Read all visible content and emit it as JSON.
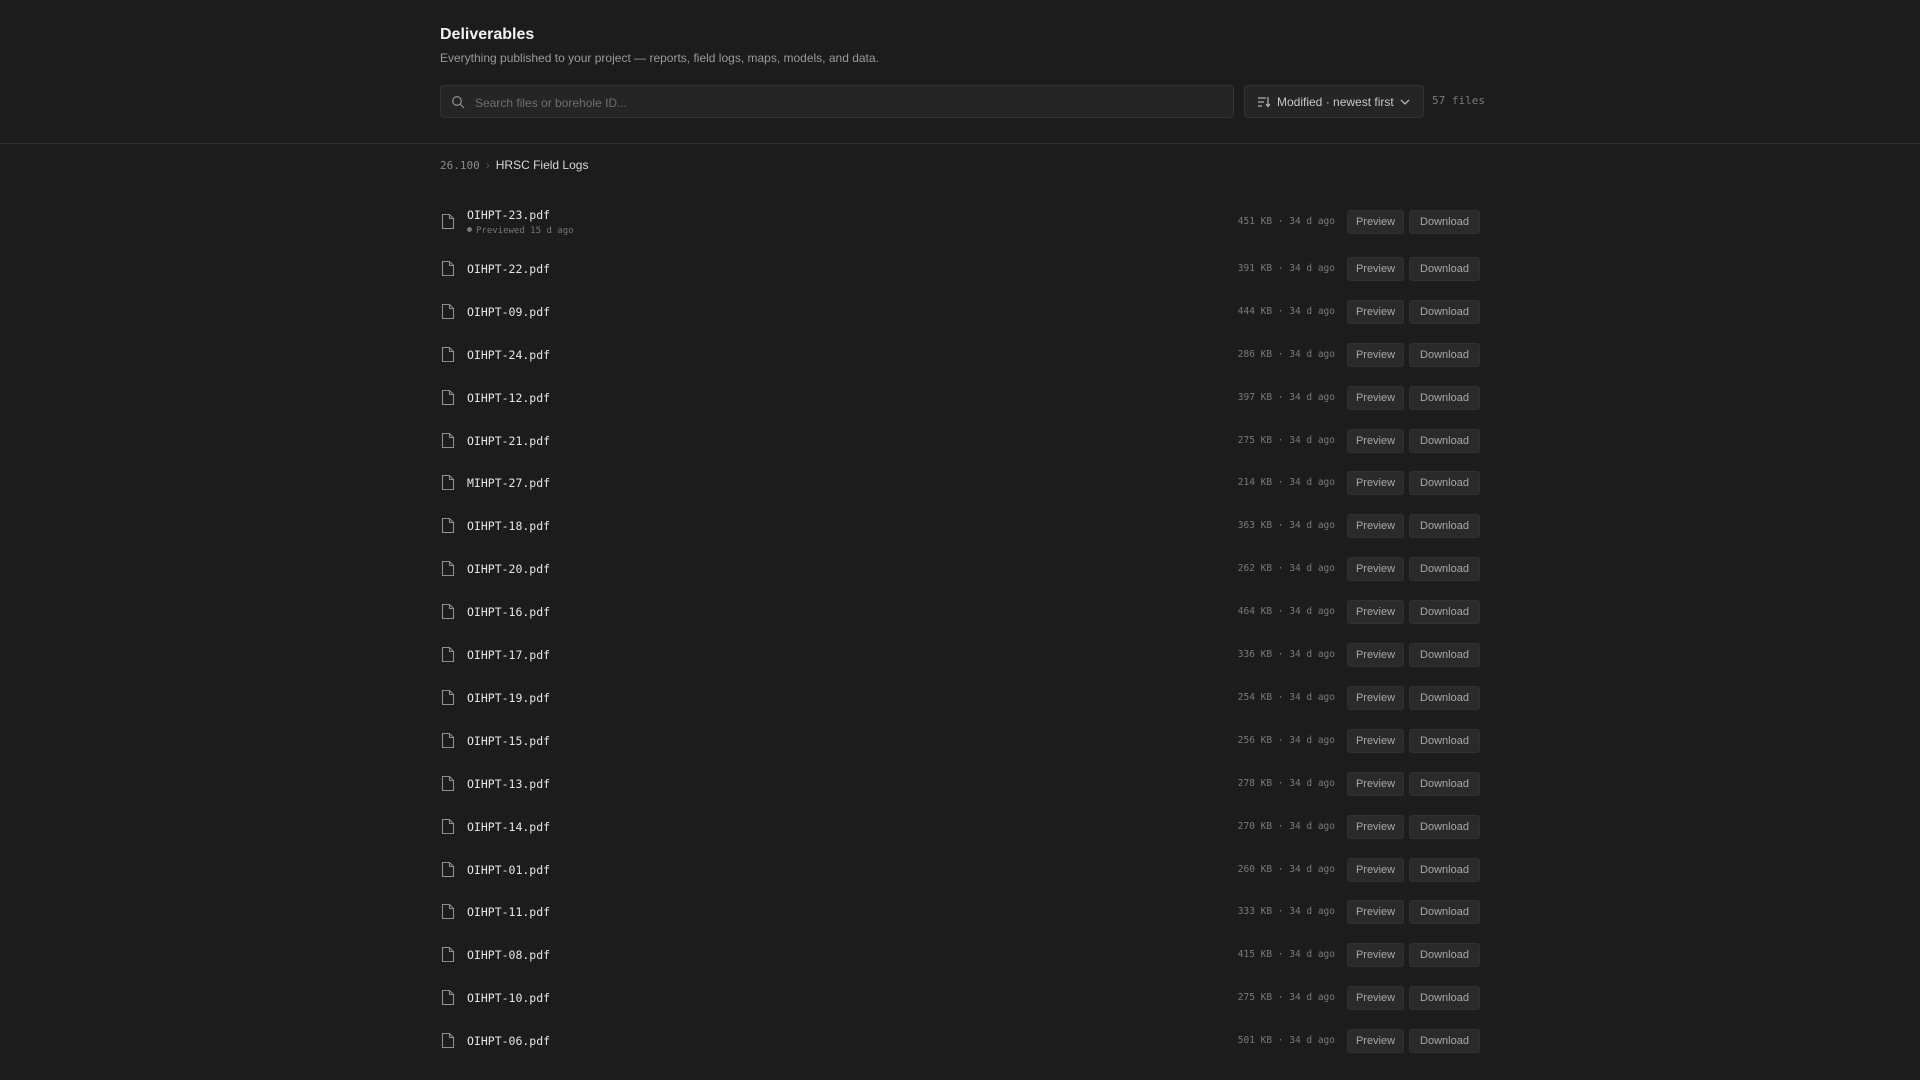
{
  "page": {
    "title": "Deliverables",
    "subtitle": "Everything published to your project — reports, field logs, maps, models, and data."
  },
  "search": {
    "placeholder": "Search files or borehole ID...",
    "icon": "search-icon"
  },
  "sort": {
    "label": "Modified · newest first",
    "icon": "sort-icon"
  },
  "file_count": "57 files",
  "breadcrumb": {
    "id": "26.100",
    "separator": "›",
    "name": "HRSC Field Logs"
  },
  "actions": {
    "preview_label": "Preview",
    "download_label": "Download"
  },
  "files": [
    {
      "name": "OIHPT-23.pdf",
      "meta": "451 KB · 34 d ago",
      "sub": "Previewed 15 d ago"
    },
    {
      "name": "OIHPT-22.pdf",
      "meta": "391 KB · 34 d ago"
    },
    {
      "name": "OIHPT-09.pdf",
      "meta": "444 KB · 34 d ago"
    },
    {
      "name": "OIHPT-24.pdf",
      "meta": "286 KB · 34 d ago"
    },
    {
      "name": "OIHPT-12.pdf",
      "meta": "397 KB · 34 d ago"
    },
    {
      "name": "OIHPT-21.pdf",
      "meta": "275 KB · 34 d ago"
    },
    {
      "name": "MIHPT-27.pdf",
      "meta": "214 KB · 34 d ago"
    },
    {
      "name": "OIHPT-18.pdf",
      "meta": "363 KB · 34 d ago"
    },
    {
      "name": "OIHPT-20.pdf",
      "meta": "262 KB · 34 d ago"
    },
    {
      "name": "OIHPT-16.pdf",
      "meta": "464 KB · 34 d ago"
    },
    {
      "name": "OIHPT-17.pdf",
      "meta": "336 KB · 34 d ago"
    },
    {
      "name": "OIHPT-19.pdf",
      "meta": "254 KB · 34 d ago"
    },
    {
      "name": "OIHPT-15.pdf",
      "meta": "256 KB · 34 d ago"
    },
    {
      "name": "OIHPT-13.pdf",
      "meta": "278 KB · 34 d ago"
    },
    {
      "name": "OIHPT-14.pdf",
      "meta": "270 KB · 34 d ago"
    },
    {
      "name": "OIHPT-01.pdf",
      "meta": "260 KB · 34 d ago"
    },
    {
      "name": "OIHPT-11.pdf",
      "meta": "333 KB · 34 d ago"
    },
    {
      "name": "OIHPT-08.pdf",
      "meta": "415 KB · 34 d ago"
    },
    {
      "name": "OIHPT-10.pdf",
      "meta": "275 KB · 34 d ago"
    },
    {
      "name": "OIHPT-06.pdf",
      "meta": "501 KB · 34 d ago"
    }
  ]
}
